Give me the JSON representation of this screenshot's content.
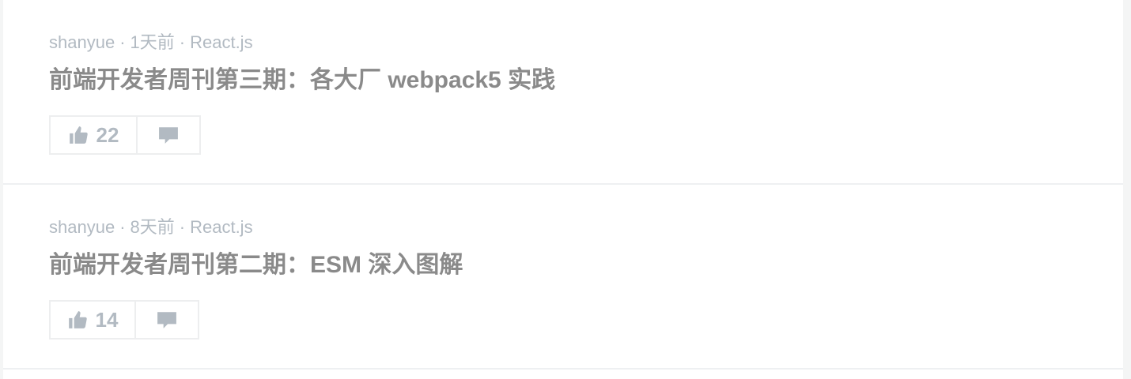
{
  "entries": [
    {
      "author": "shanyue",
      "separator": "·",
      "time": "1天前",
      "tag": "React.js",
      "title": "前端开发者周刊第三期：各大厂 webpack5 实践",
      "likes": "22",
      "like_icon": "thumbs-up-icon",
      "comment_icon": "comment-icon"
    },
    {
      "author": "shanyue",
      "separator": "·",
      "time": "8天前",
      "tag": "React.js",
      "title": "前端开发者周刊第二期：ESM 深入图解",
      "likes": "14",
      "like_icon": "thumbs-up-icon",
      "comment_icon": "comment-icon"
    }
  ],
  "colors": {
    "meta_text": "#b2bac2",
    "title_text": "#8a8a8a",
    "border": "#edeeef",
    "background": "#ffffff"
  }
}
